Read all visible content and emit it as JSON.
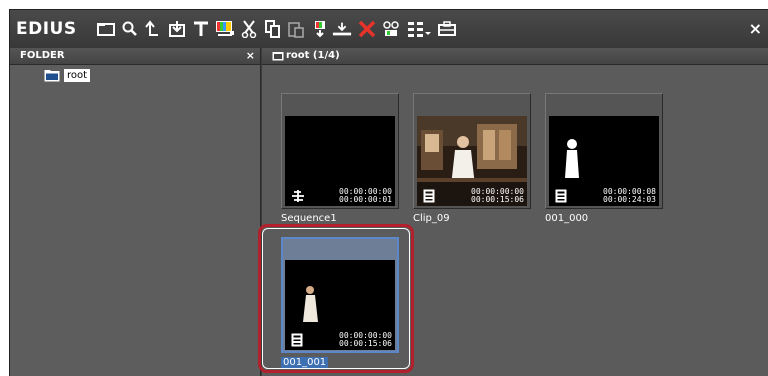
{
  "app": {
    "title": "EDIUS",
    "close_label": "×"
  },
  "toolbar": {
    "icons": [
      "new-folder-icon",
      "search-icon",
      "up-folder-icon",
      "import-icon",
      "title-icon",
      "color-bar-icon",
      "cut-icon",
      "copy-icon",
      "paste-icon",
      "add-to-timeline-icon",
      "insert-icon",
      "delete-icon",
      "properties-icon",
      "view-mode-icon",
      "dropdown-icon",
      "toolbox-icon"
    ]
  },
  "folder_panel": {
    "header": "FOLDER",
    "close_label": "×",
    "root_label": "root"
  },
  "bin_panel": {
    "header": "root (1/4)"
  },
  "clips": [
    {
      "name": "Sequence1",
      "tc_in": "00:00:00:00",
      "tc_dur": "00:00:00:01",
      "kind": "sequence"
    },
    {
      "name": "Clip_09",
      "tc_in": "00:00:00:00",
      "tc_dur": "00:00:15:06",
      "kind": "video"
    },
    {
      "name": "001_000",
      "tc_in": "00:00:00:08",
      "tc_dur": "00:00:24:03",
      "kind": "video"
    },
    {
      "name": "001_001",
      "tc_in": "00:00:00:00",
      "tc_dur": "00:00:15:06",
      "kind": "video",
      "selected": true
    }
  ],
  "colors": {
    "highlight": "#b3202b",
    "selection": "#3d6fb3",
    "delete_icon": "#e8332a"
  }
}
